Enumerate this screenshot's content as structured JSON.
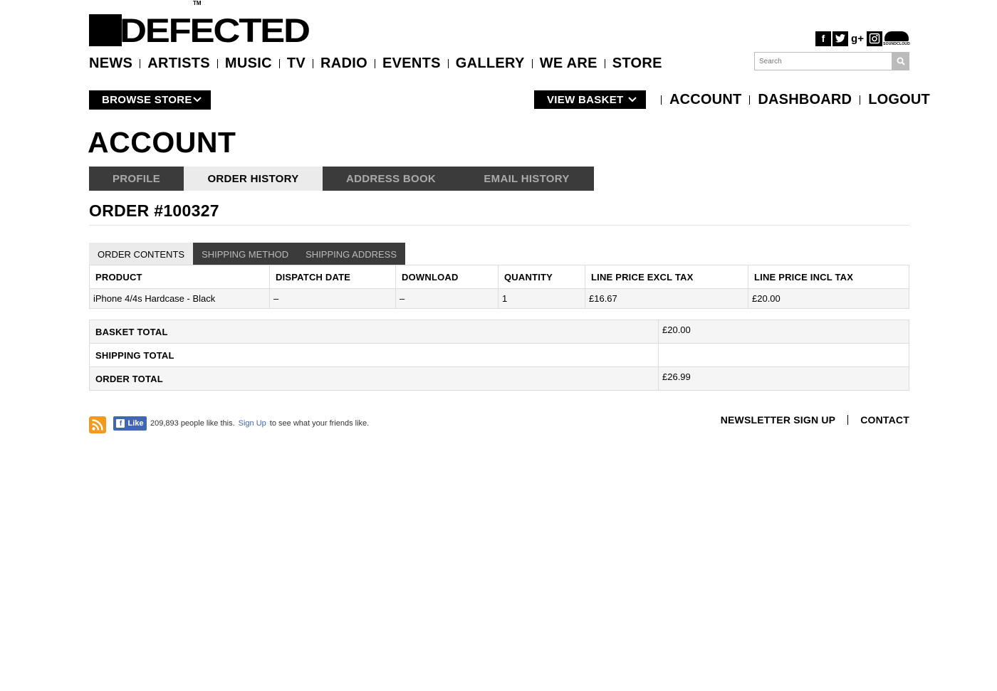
{
  "logo": {
    "text": "DEFECTED",
    "tm": "TM"
  },
  "social": {
    "icons": [
      "facebook-icon",
      "twitter-icon",
      "google-plus-icon",
      "instagram-icon",
      "soundcloud-icon"
    ],
    "soundcloud_label": "SOUNDCLOUD"
  },
  "nav": [
    "NEWS",
    "ARTISTS",
    "MUSIC",
    "TV",
    "RADIO",
    "EVENTS",
    "GALLERY",
    "WE ARE",
    "STORE"
  ],
  "search": {
    "placeholder": "Search"
  },
  "store": {
    "browse_label": "BROWSE STORE",
    "basket_label": "VIEW BASKET",
    "links": [
      "ACCOUNT",
      "DASHBOARD",
      "LOGOUT"
    ]
  },
  "page_title": "ACCOUNT",
  "account_tabs": [
    "PROFILE",
    "ORDER HISTORY",
    "ADDRESS BOOK",
    "EMAIL HISTORY"
  ],
  "active_account_tab": "ORDER HISTORY",
  "order_title": "ORDER #100327",
  "order_tabs": [
    "ORDER CONTENTS",
    "SHIPPING METHOD",
    "SHIPPING ADDRESS"
  ],
  "active_order_tab": "ORDER CONTENTS",
  "items_table": {
    "headers": [
      "PRODUCT",
      "DISPATCH DATE",
      "DOWNLOAD",
      "QUANTITY",
      "LINE PRICE EXCL TAX",
      "LINE PRICE INCL TAX"
    ],
    "rows": [
      [
        "iPhone 4/4s Hardcase - Black",
        "–",
        "–",
        "1",
        "£16.67",
        "£20.00"
      ]
    ]
  },
  "totals": [
    {
      "label": "BASKET TOTAL",
      "value": "£20.00"
    },
    {
      "label": "SHIPPING TOTAL",
      "value": ""
    },
    {
      "label": "ORDER TOTAL",
      "value": "£26.99"
    }
  ],
  "footer": {
    "fb_like_label": "Like",
    "fb_count_text": "209,893 people like this.",
    "fb_signup": "Sign Up",
    "fb_suffix": "to see what your friends like.",
    "links": [
      "NEWSLETTER SIGN UP",
      "CONTACT"
    ]
  },
  "colors": {
    "tab_dark": "#3b3b3b",
    "tab_active": "#ebebeb",
    "fb_blue": "#4267b2",
    "rss_orange": "#f39a1d"
  }
}
